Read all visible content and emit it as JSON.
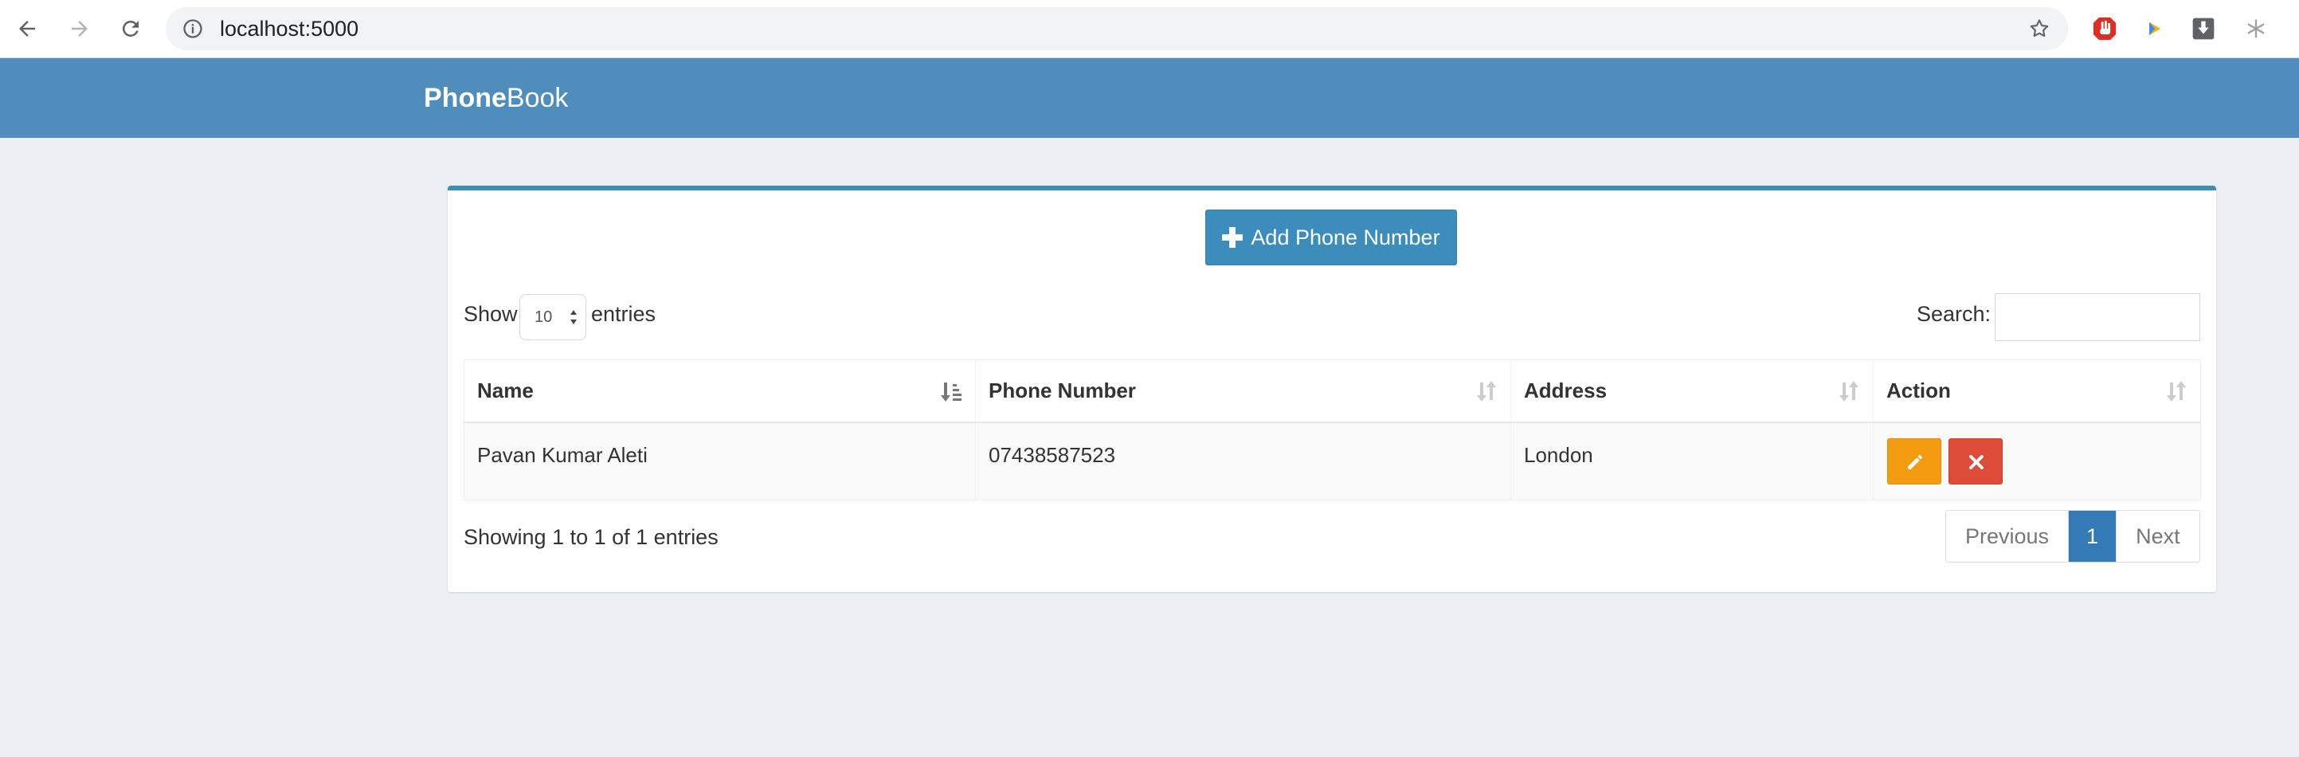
{
  "browser": {
    "url": "localhost:5000",
    "icons": [
      "back-arrow-icon",
      "forward-arrow-icon",
      "reload-icon",
      "info-icon",
      "star-icon"
    ],
    "extensions": [
      "stop-hand-icon",
      "play-icon",
      "download-icon",
      "snowflake-icon"
    ]
  },
  "header": {
    "brand_bold": "Phone",
    "brand_light": "Book",
    "color": "#4f8dbd"
  },
  "panel": {
    "add_button": "Add Phone Number",
    "show_label": "Show",
    "page_length": "10",
    "entries_label": "entries",
    "search_label": "Search:",
    "search_value": ""
  },
  "table": {
    "columns": [
      "Name",
      "Phone Number",
      "Address",
      "Action"
    ],
    "rows": [
      {
        "name": "Pavan Kumar Aleti",
        "phone": "07438587523",
        "address": "London"
      }
    ]
  },
  "footer": {
    "info": "Showing 1 to 1 of 1 entries",
    "previous": "Previous",
    "current_page": "1",
    "next": "Next"
  },
  "colors": {
    "accent": "#3c8dbc",
    "edit": "#f39c12",
    "delete": "#dd4b39",
    "background": "#ecf0f5"
  }
}
